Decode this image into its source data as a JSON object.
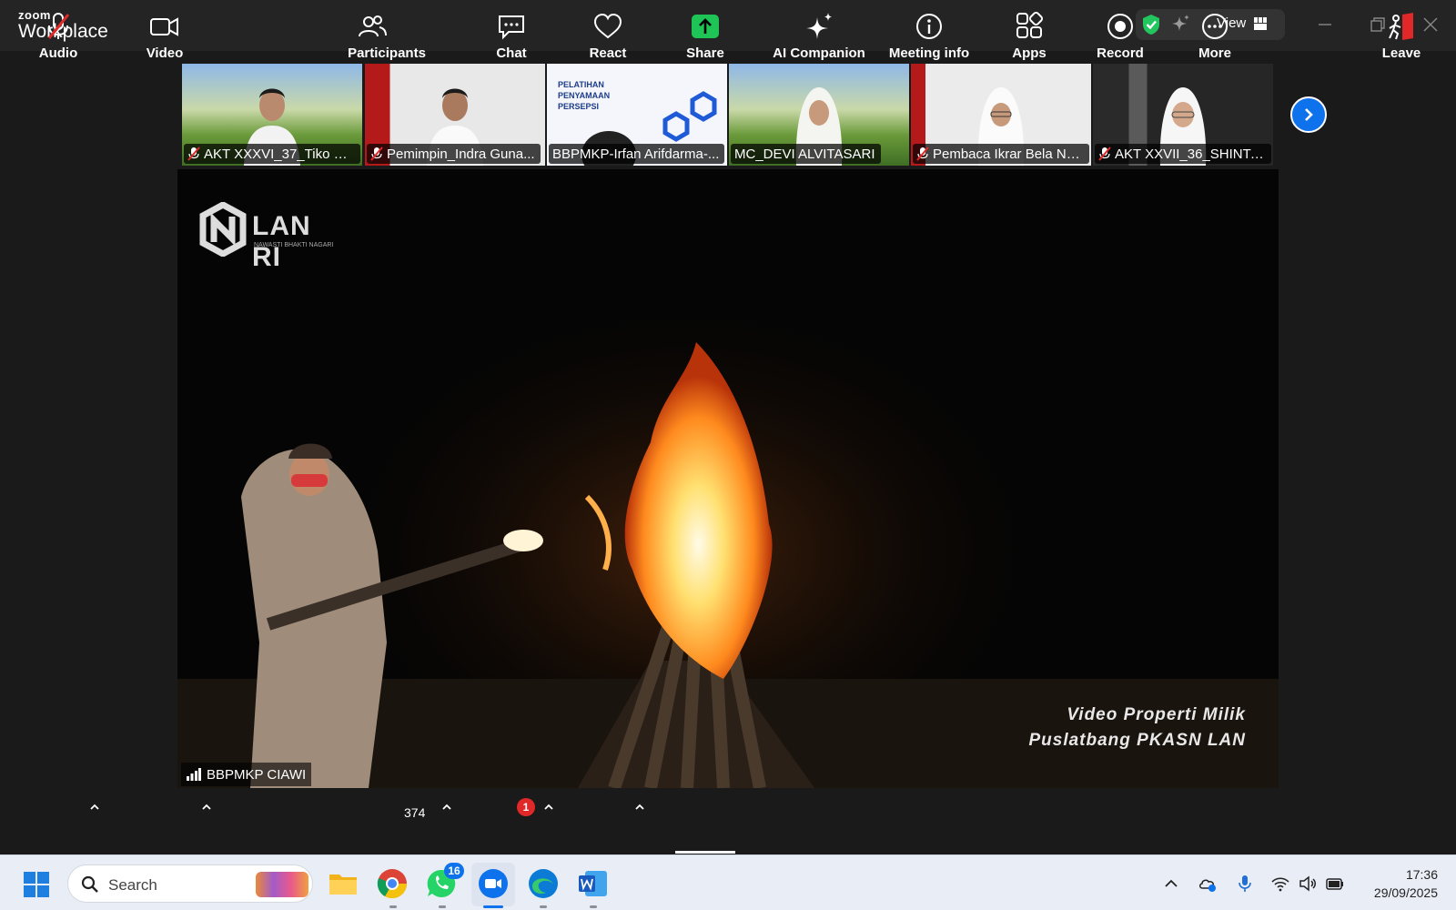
{
  "titlebar": {
    "brand_small": "zoom",
    "brand_big": "Workplace",
    "view_label": "View"
  },
  "thumbnails": [
    {
      "name": "AKT XXXVI_37_Tiko Dh...",
      "muted": true
    },
    {
      "name": "Pemimpin_Indra Guna...",
      "muted": true
    },
    {
      "name": "BBPMKP-Irfan Arifdarma-...",
      "muted": false
    },
    {
      "name": "MC_DEVI ALVITASARI",
      "muted": false
    },
    {
      "name": "Pembaca Ikrar Bela Ne...",
      "muted": true
    },
    {
      "name": "AKT XXVII_36_SHINTA ...",
      "muted": true
    }
  ],
  "main_video": {
    "logo_text": "LAN RI",
    "logo_sub": "NAWASTI BHAKTI NAGARI",
    "watermark_line1": "Video Properti Milik",
    "watermark_line2": "Puslatbang PKASN LAN",
    "speaker_name": "BBPMKP CIAWI"
  },
  "toolbar": {
    "audio": "Audio",
    "video": "Video",
    "participants": "Participants",
    "participants_count": "374",
    "chat": "Chat",
    "chat_badge": "1",
    "react": "React",
    "share": "Share",
    "ai_companion": "AI Companion",
    "meeting_info": "Meeting info",
    "apps": "Apps",
    "record": "Record",
    "more": "More",
    "leave": "Leave"
  },
  "taskbar": {
    "search_placeholder": "Search",
    "whatsapp_badge": "16",
    "time": "17:36",
    "date": "29/09/2025"
  },
  "colors": {
    "zoom_blue": "#0e72ed",
    "share_green": "#1fc456",
    "leave_red": "#e02828",
    "shield_green": "#22c55e"
  }
}
